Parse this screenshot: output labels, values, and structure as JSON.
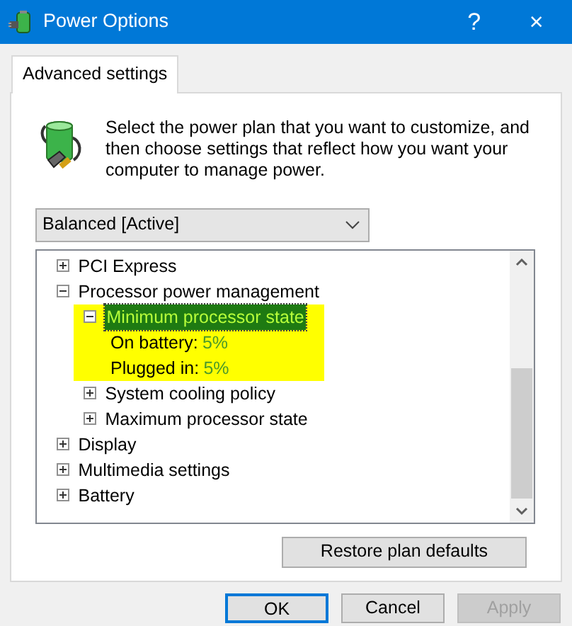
{
  "window": {
    "title": "Power Options",
    "help": "?",
    "close": "×"
  },
  "tabs": [
    {
      "label": "Advanced settings",
      "selected": true
    }
  ],
  "intro": "Select the power plan that you want to customize, and then choose settings that reflect how you want your computer to manage power.",
  "plan_select": {
    "value": "Balanced [Active]"
  },
  "tree": [
    {
      "kind": "group",
      "label": "PCI Express",
      "expanded": false,
      "selected": false,
      "highlighted": false
    },
    {
      "kind": "group",
      "label": "Processor power management",
      "expanded": true,
      "selected": false,
      "highlighted": false,
      "children": [
        {
          "kind": "group",
          "label": "Minimum processor state",
          "expanded": true,
          "selected": true,
          "highlighted": true,
          "children": [
            {
              "kind": "setting",
              "label": "On battery:",
              "value": "5%"
            },
            {
              "kind": "setting",
              "label": "Plugged in:",
              "value": "5%"
            }
          ]
        },
        {
          "kind": "group",
          "label": "System cooling policy",
          "expanded": false,
          "selected": false,
          "highlighted": false
        },
        {
          "kind": "group",
          "label": "Maximum processor state",
          "expanded": false,
          "selected": false,
          "highlighted": false
        }
      ]
    },
    {
      "kind": "group",
      "label": "Display",
      "expanded": false,
      "selected": false,
      "highlighted": false
    },
    {
      "kind": "group",
      "label": "Multimedia settings",
      "expanded": false,
      "selected": false,
      "highlighted": false
    },
    {
      "kind": "group",
      "label": "Battery",
      "expanded": false,
      "selected": false,
      "highlighted": false
    }
  ],
  "restore_button": {
    "label": "Restore plan defaults"
  },
  "buttons": [
    {
      "label": "OK",
      "default": true,
      "disabled": false
    },
    {
      "label": "Cancel",
      "default": false,
      "disabled": false
    },
    {
      "label": "Apply",
      "default": false,
      "disabled": true
    }
  ]
}
